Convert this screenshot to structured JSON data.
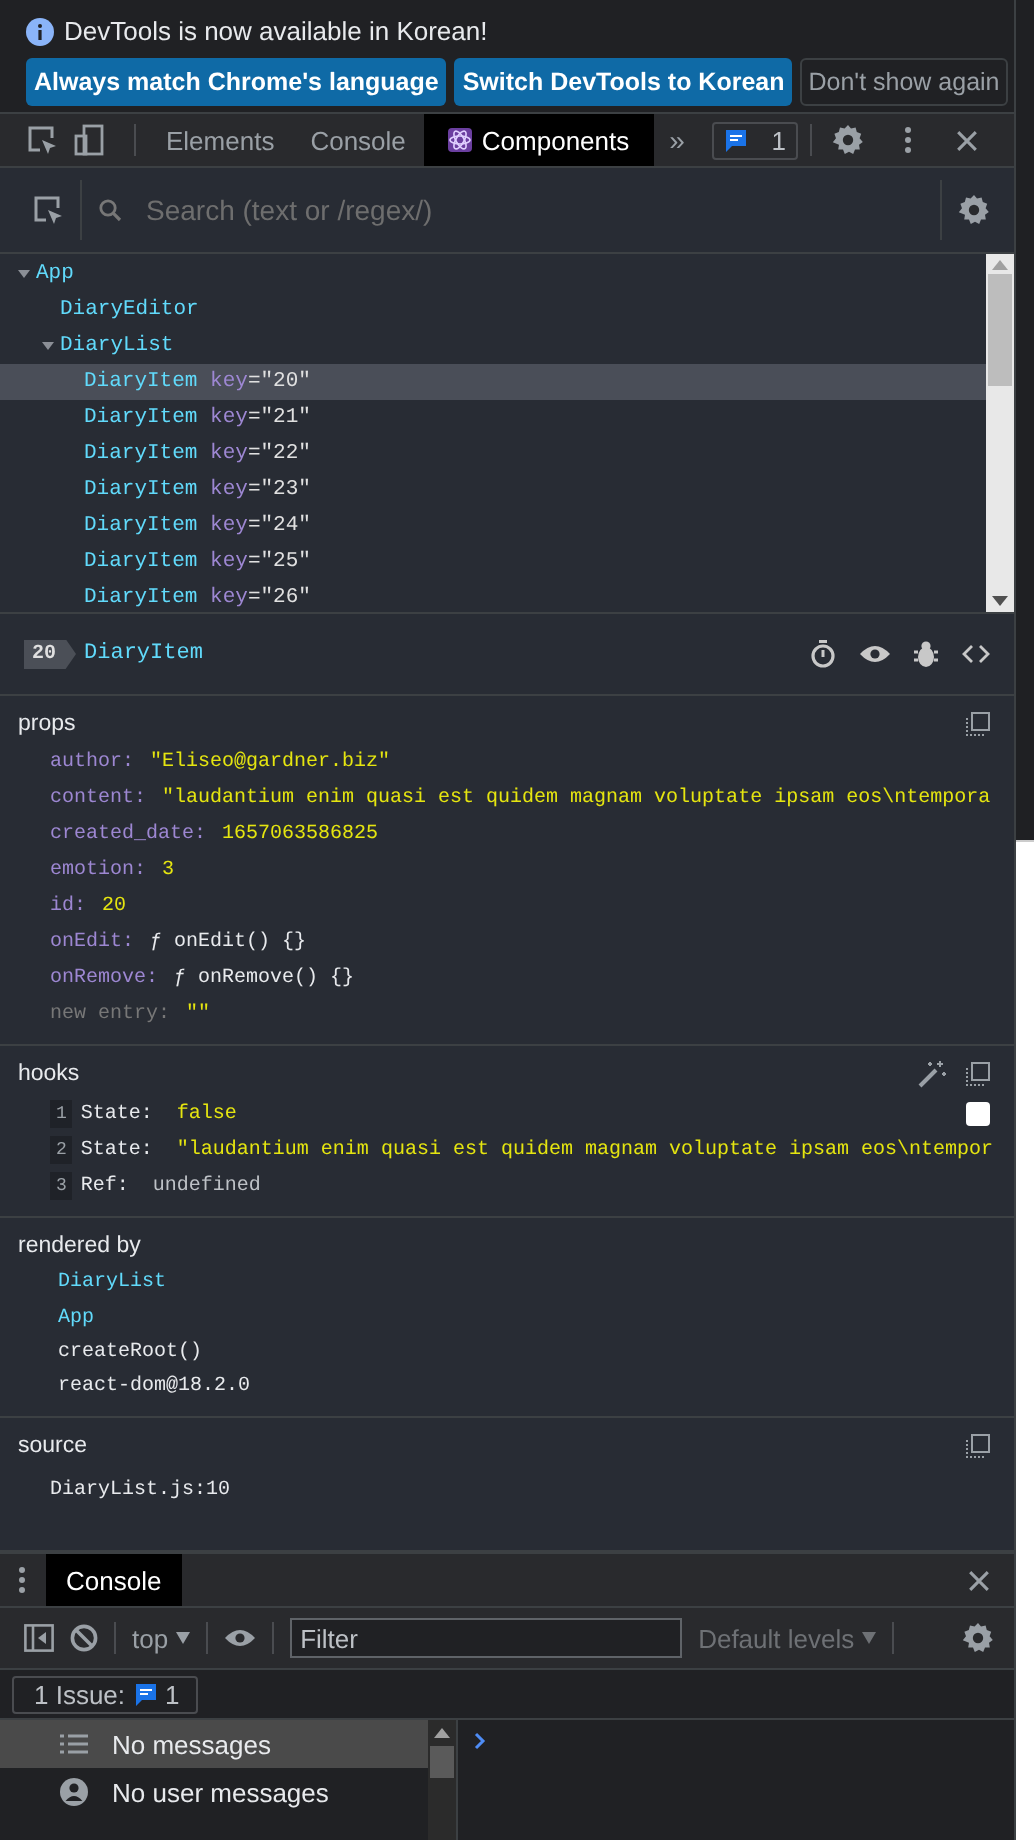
{
  "notification": {
    "text": "DevTools is now available in Korean!",
    "buttons": [
      {
        "label": "Always match Chrome's language",
        "kind": "primary"
      },
      {
        "label": "Switch DevTools to Korean",
        "kind": "primary"
      },
      {
        "label": "Don't show again",
        "kind": "secondary"
      }
    ]
  },
  "toolbar": {
    "tabs": [
      {
        "label": "Elements",
        "selected": false,
        "kind": "plain"
      },
      {
        "label": "Console",
        "selected": false,
        "kind": "plain"
      },
      {
        "label": "Components",
        "selected": true,
        "kind": "react"
      }
    ],
    "overflow": "»",
    "issues_count": "1"
  },
  "search": {
    "placeholder": "Search (text or /regex/)"
  },
  "tree": [
    {
      "name": "App",
      "expanded": true,
      "selected": false,
      "children": [
        {
          "name": "DiaryEditor",
          "selected": false
        },
        {
          "name": "DiaryList",
          "expanded": true,
          "selected": false,
          "children": [
            {
              "name": "DiaryItem",
              "key": "key=\"20\"",
              "selected": true
            },
            {
              "name": "DiaryItem",
              "key": "key=\"21\"",
              "selected": false
            },
            {
              "name": "DiaryItem",
              "key": "key=\"22\"",
              "selected": false
            },
            {
              "name": "DiaryItem",
              "key": "key=\"23\"",
              "selected": false
            },
            {
              "name": "DiaryItem",
              "key": "key=\"24\"",
              "selected": false
            },
            {
              "name": "DiaryItem",
              "key": "key=\"25\"",
              "selected": false
            },
            {
              "name": "DiaryItem",
              "key": "key=\"26\"",
              "selected": false
            }
          ]
        }
      ]
    }
  ],
  "selected_component": {
    "badge": "20",
    "name": "DiaryItem"
  },
  "props": {
    "title": "props",
    "items": [
      {
        "key": "author:",
        "value": "\"Eliseo@gardner.biz\"",
        "kind": "string"
      },
      {
        "key": "content:",
        "value": "\"laudantium enim quasi est quidem magnam voluptate ipsam eos\\ntempora",
        "kind": "string"
      },
      {
        "key": "created_date:",
        "value": "1657063586825",
        "kind": "number"
      },
      {
        "key": "emotion:",
        "value": "3",
        "kind": "number"
      },
      {
        "key": "id:",
        "value": "20",
        "kind": "number"
      },
      {
        "key": "onEdit:",
        "value": "ƒ onEdit() {}",
        "kind": "function"
      },
      {
        "key": "onRemove:",
        "value": "ƒ onRemove() {}",
        "kind": "function"
      },
      {
        "key": "new entry:",
        "value": "\"\"",
        "kind": "new"
      }
    ]
  },
  "hooks": {
    "title": "hooks",
    "items": [
      {
        "index": "1",
        "name": "State:",
        "value": "false",
        "kind": "string",
        "checked": false
      },
      {
        "index": "2",
        "name": "State:",
        "value": "\"laudantium enim quasi est quidem magnam voluptate ipsam eos\\ntempor",
        "kind": "string"
      },
      {
        "index": "3",
        "name": "Ref:",
        "value": "undefined",
        "kind": "plain"
      }
    ]
  },
  "rendered_by": {
    "title": "rendered by",
    "items": [
      {
        "name": "DiaryList",
        "kind": "component"
      },
      {
        "name": "App",
        "kind": "component"
      },
      {
        "name": "createRoot()",
        "kind": "plain"
      },
      {
        "name": "react-dom@18.2.0",
        "kind": "plain"
      }
    ]
  },
  "source": {
    "title": "source",
    "location": "DiaryList.js:10"
  },
  "drawer": {
    "tab": "Console",
    "context": "top",
    "filter_placeholder": "Filter",
    "levels": "Default levels",
    "issues_label": "1 Issue:",
    "issues_count": "1",
    "sidebar": [
      {
        "label": "No messages",
        "selected": true,
        "kind": "list"
      },
      {
        "label": "No user messages",
        "selected": false,
        "kind": "user"
      }
    ]
  }
}
